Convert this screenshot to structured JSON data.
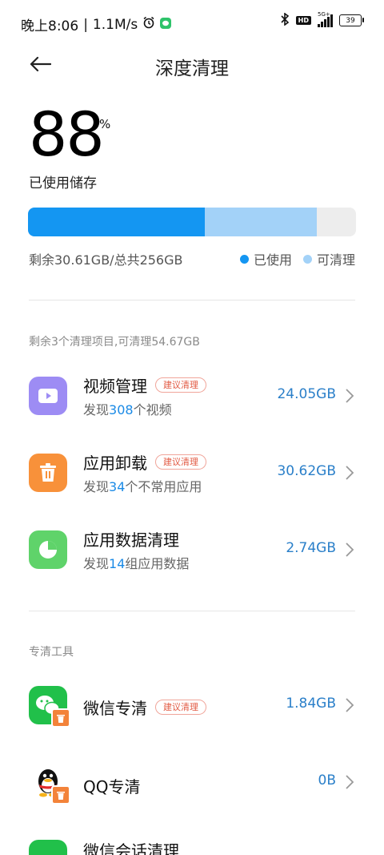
{
  "status_bar": {
    "time": "晚上8:06",
    "speed": "1.1M/s",
    "hd": "HD",
    "network": "5G+",
    "battery": "39"
  },
  "header": {
    "title": "深度清理"
  },
  "storage": {
    "percent": "88",
    "percent_sign": "%",
    "used_label": "已使用储存",
    "summary": "剩余30.61GB/总共256GB",
    "legend_used": "已使用",
    "legend_cleanable": "可清理",
    "used_fraction": 0.54,
    "cleanable_fraction": 0.34,
    "colors": {
      "used": "#1496f2",
      "cleanable": "#a3d2f8",
      "free": "#ededed"
    }
  },
  "clean_section": {
    "label": "剩余3个清理项目,可清理54.67GB",
    "items": [
      {
        "title": "视频管理",
        "tag": "建议清理",
        "sub_prefix": "发现",
        "sub_count": "308",
        "sub_suffix": "个视频",
        "size": "24.05GB",
        "icon": "video-icon"
      },
      {
        "title": "应用卸载",
        "tag": "建议清理",
        "sub_prefix": "发现",
        "sub_count": "34",
        "sub_suffix": "个不常用应用",
        "size": "30.62GB",
        "icon": "trash-icon"
      },
      {
        "title": "应用数据清理",
        "sub_prefix": "发现",
        "sub_count": "14",
        "sub_suffix": "组应用数据",
        "size": "2.74GB",
        "icon": "pie-chart-icon"
      }
    ]
  },
  "tools_section": {
    "label": "专清工具",
    "items": [
      {
        "title": "微信专清",
        "tag": "建议清理",
        "size": "1.84GB",
        "icon": "wechat-icon"
      },
      {
        "title": "QQ专清",
        "size": "0B",
        "icon": "qq-icon"
      },
      {
        "title": "微信会话清理",
        "icon": "wechat-chat-icon"
      }
    ]
  }
}
